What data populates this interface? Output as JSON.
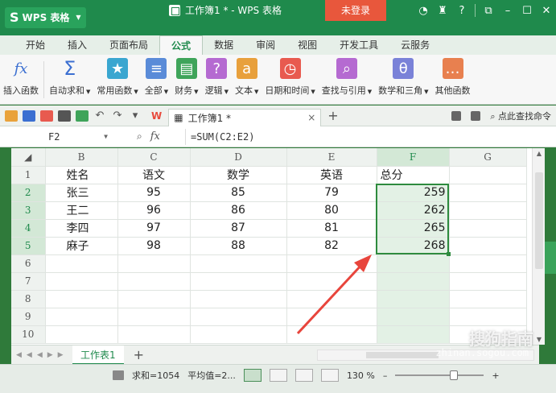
{
  "app": {
    "logo": "WPS 表格",
    "doc_title": "工作簿1 * - WPS 表格",
    "login_label": "未登录",
    "help": "?"
  },
  "tabs": [
    "开始",
    "插入",
    "页面布局",
    "公式",
    "数据",
    "审阅",
    "视图",
    "开发工具",
    "云服务"
  ],
  "active_tab": "公式",
  "ribbon": [
    {
      "label": "插入函数",
      "icon": "fx-icon",
      "dropdown": false
    },
    {
      "label": "自动求和",
      "icon": "sigma-icon",
      "dropdown": true
    },
    {
      "label": "常用函数",
      "icon": "star-icon",
      "dropdown": true
    },
    {
      "label": "全部",
      "icon": "list-icon",
      "dropdown": true
    },
    {
      "label": "财务",
      "icon": "finance-icon",
      "dropdown": true
    },
    {
      "label": "逻辑",
      "icon": "logic-icon",
      "dropdown": true
    },
    {
      "label": "文本",
      "icon": "text-icon",
      "dropdown": true
    },
    {
      "label": "日期和时间",
      "icon": "clock-icon",
      "dropdown": true
    },
    {
      "label": "查找与引用",
      "icon": "lookup-icon",
      "dropdown": true
    },
    {
      "label": "数学和三角",
      "icon": "math-icon",
      "dropdown": true
    },
    {
      "label": "其他函数",
      "icon": "more-icon",
      "dropdown": false
    }
  ],
  "doc_tab": {
    "label": "工作簿1 *",
    "close": "×",
    "add": "+"
  },
  "qat_right": {
    "search": "点此查找命令"
  },
  "formula_bar": {
    "name_box": "F2",
    "fx": "fx",
    "formula": "=SUM(C2:E2)"
  },
  "columns": [
    "B",
    "C",
    "D",
    "E",
    "F",
    "G"
  ],
  "selected_column": "F",
  "rows": [
    {
      "n": "1",
      "cells": [
        "姓名",
        "语文",
        "数学",
        "英语",
        "总分",
        ""
      ]
    },
    {
      "n": "2",
      "cells": [
        "张三",
        "95",
        "85",
        "79",
        "259",
        ""
      ]
    },
    {
      "n": "3",
      "cells": [
        "王二",
        "96",
        "86",
        "80",
        "262",
        ""
      ]
    },
    {
      "n": "4",
      "cells": [
        "李四",
        "97",
        "87",
        "81",
        "265",
        ""
      ]
    },
    {
      "n": "5",
      "cells": [
        "麻子",
        "98",
        "88",
        "82",
        "268",
        ""
      ]
    },
    {
      "n": "6",
      "cells": [
        "",
        "",
        "",
        "",
        "",
        ""
      ]
    },
    {
      "n": "7",
      "cells": [
        "",
        "",
        "",
        "",
        "",
        ""
      ]
    },
    {
      "n": "8",
      "cells": [
        "",
        "",
        "",
        "",
        "",
        ""
      ]
    },
    {
      "n": "9",
      "cells": [
        "",
        "",
        "",
        "",
        "",
        ""
      ]
    },
    {
      "n": "10",
      "cells": [
        "",
        "",
        "",
        "",
        "",
        ""
      ]
    }
  ],
  "selected_rows": [
    "2",
    "3",
    "4",
    "5"
  ],
  "sheet_tab": "工作表1",
  "sheet_add": "+",
  "status": {
    "sum": "求和=1054",
    "avg": "平均值=2...",
    "zoom": "130 %",
    "minus": "–",
    "plus": "+"
  },
  "watermark": {
    "main": "搜狗指南",
    "sub": "zhinan.sogou.com"
  },
  "colors": {
    "title_bg": "#1f8a4c",
    "login_bg": "#e8573c",
    "selection": "#2e8b3e",
    "arrow": "#e8453c"
  }
}
